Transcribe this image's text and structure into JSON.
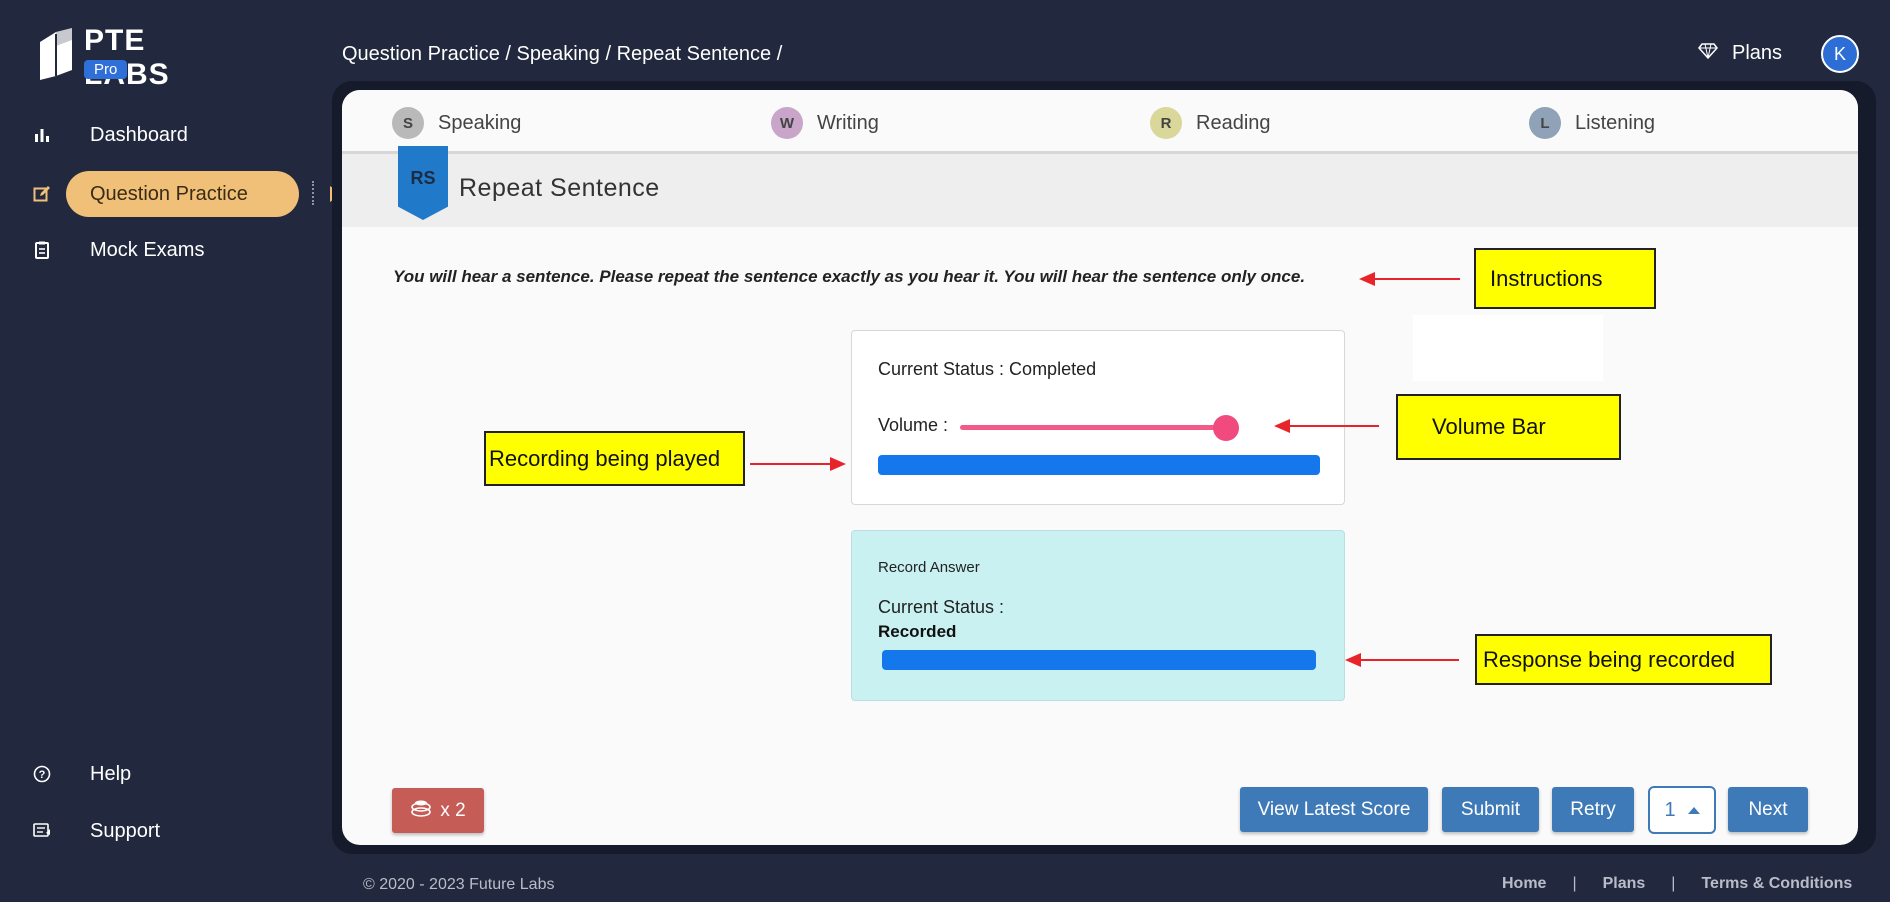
{
  "brand": {
    "name": "PTE LABS",
    "tier": "Pro"
  },
  "sidebar": {
    "items": [
      {
        "label": "Dashboard",
        "icon": "bar-chart-icon"
      },
      {
        "label": "Question Practice",
        "icon": "edit-icon",
        "active": true
      },
      {
        "label": "Mock Exams",
        "icon": "clipboard-icon"
      }
    ],
    "bottom_items": [
      {
        "label": "Help",
        "icon": "question-circle-icon"
      },
      {
        "label": "Support",
        "icon": "support-icon"
      }
    ]
  },
  "header": {
    "breadcrumb": "Question Practice / Speaking / Repeat Sentence /",
    "plans_label": "Plans",
    "avatar_initial": "K"
  },
  "tabs": [
    {
      "label": "Speaking",
      "icon_text": "S",
      "color": "#b9b9b9"
    },
    {
      "label": "Writing",
      "icon_text": "W",
      "color": "#c9a6c9"
    },
    {
      "label": "Reading",
      "icon_text": "R",
      "color": "#d9d79a"
    },
    {
      "label": "Listening",
      "icon_text": "L",
      "color": "#8fa2b8"
    }
  ],
  "question": {
    "badge": "RS",
    "title": "Repeat Sentence",
    "instructions": "You will hear a sentence. Please repeat the sentence exactly as you hear it. You will hear the sentence only once."
  },
  "player": {
    "status": "Current Status : Completed",
    "volume_label": "Volume :",
    "volume_level": 1.0,
    "progress": 1.0
  },
  "recorder": {
    "title": "Record Answer",
    "status_label": "Current Status :",
    "status_value": "Recorded",
    "progress": 1.0
  },
  "annotations": {
    "instructions": "Instructions",
    "volume_bar": "Volume Bar",
    "recording_played": "Recording being played",
    "response_recorded": "Response being recorded"
  },
  "actions": {
    "coin_count": "x 2",
    "view_latest_score": "View Latest Score",
    "submit": "Submit",
    "retry": "Retry",
    "page_number": "1",
    "next": "Next"
  },
  "footer": {
    "copyright": "© 2020 - 2023 Future Labs",
    "links": [
      "Home",
      "Plans",
      "Terms & Conditions"
    ]
  },
  "colors": {
    "background": "#22283d",
    "accent": "#f0c079",
    "primary_button": "#3f7ab8",
    "progress": "#1577ec",
    "annotation": "#ffff00",
    "arrow": "#e8242b"
  }
}
